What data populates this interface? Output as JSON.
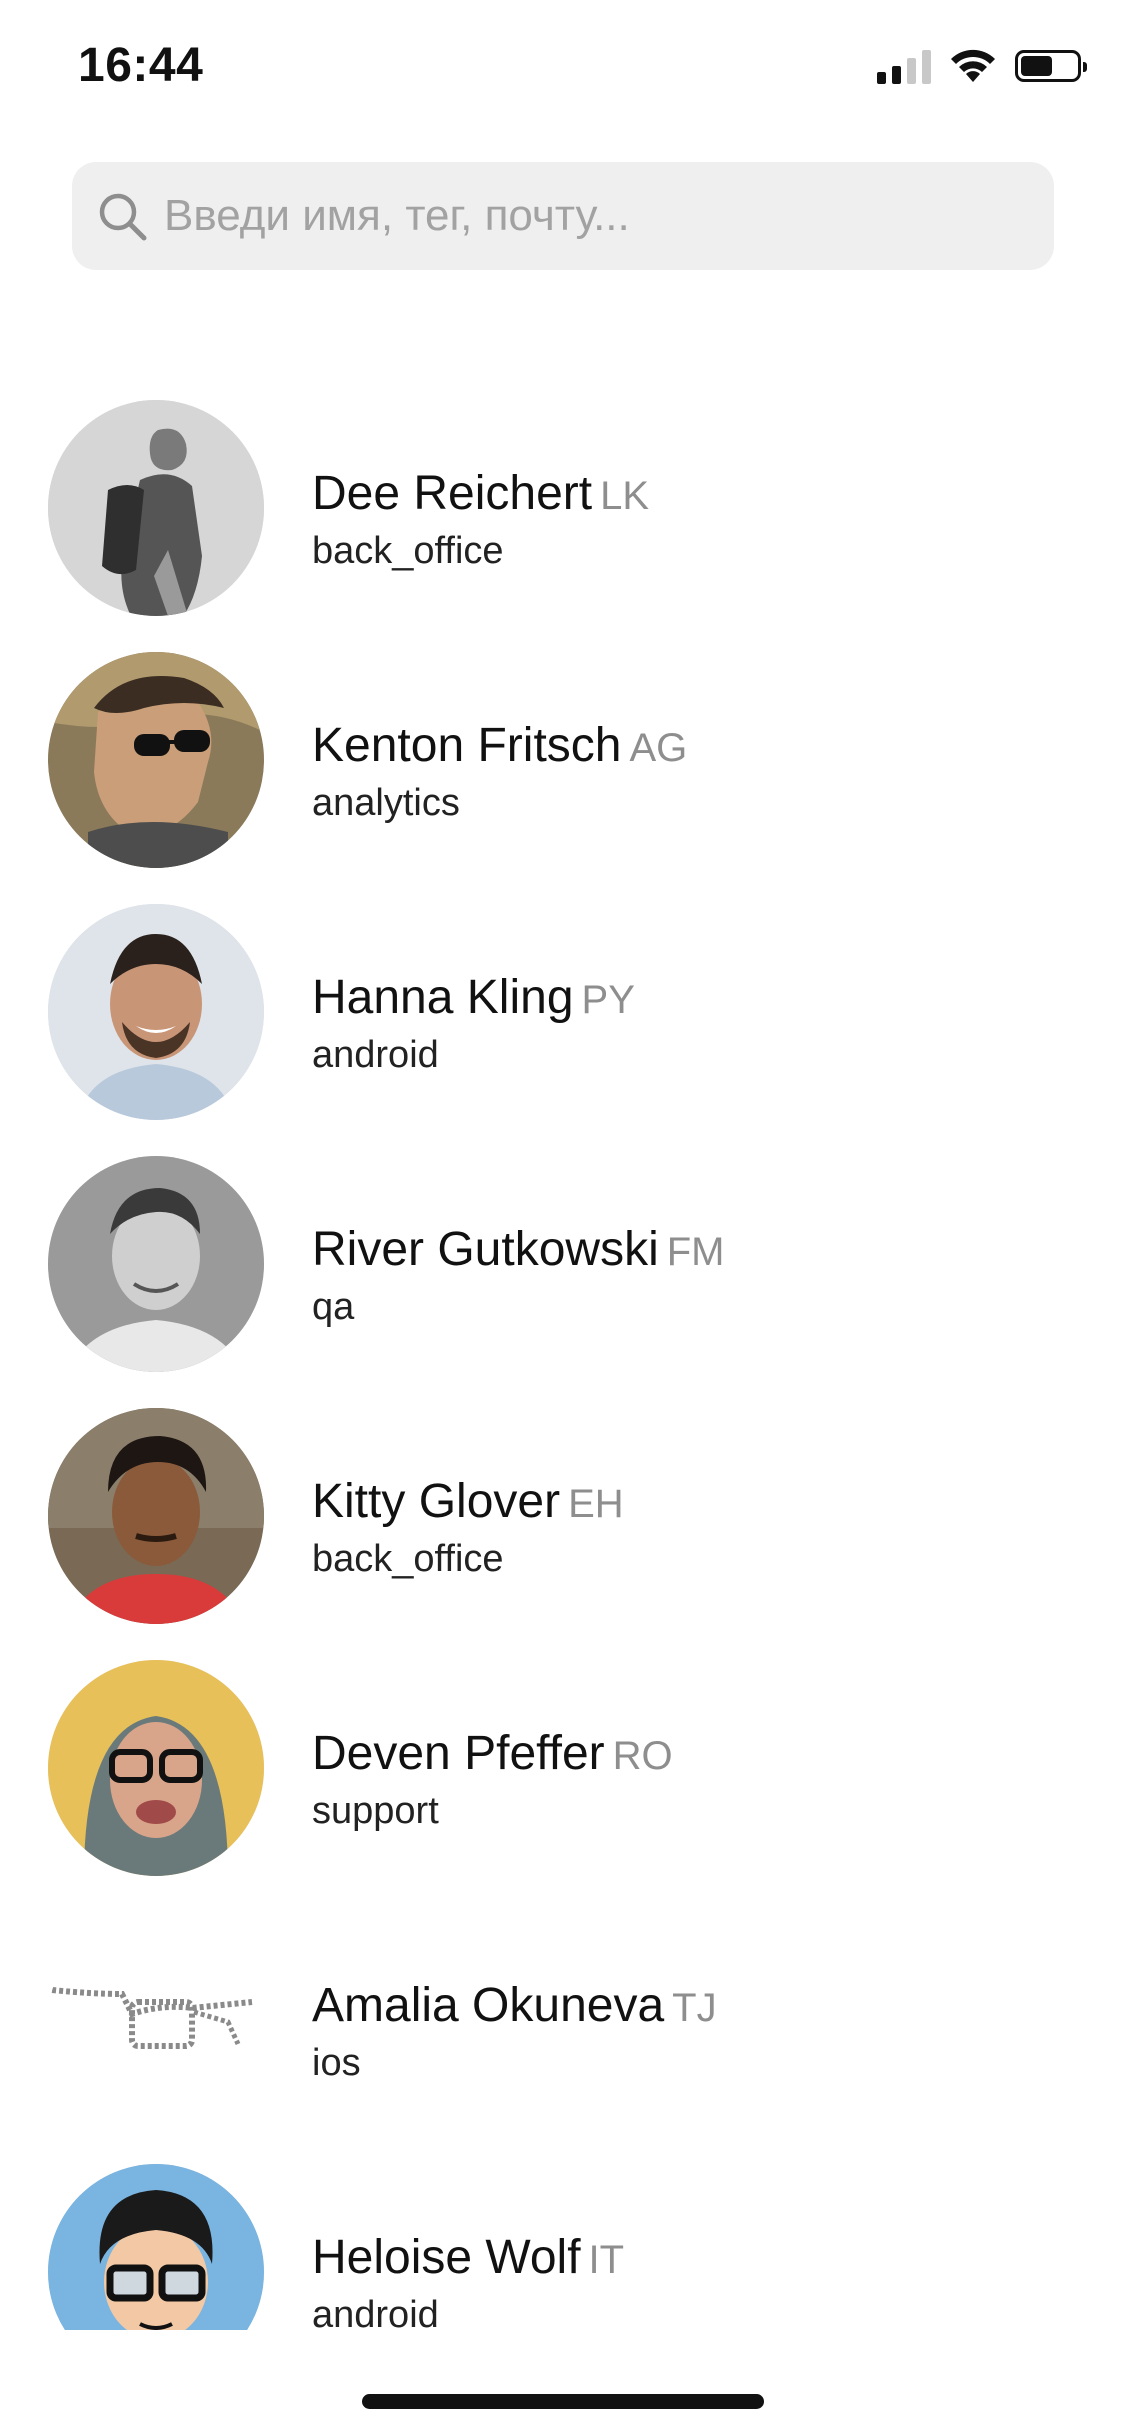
{
  "status_bar": {
    "time": "16:44",
    "icons": [
      "cellular-signal-icon",
      "wifi-icon",
      "battery-icon"
    ]
  },
  "search": {
    "placeholder": "Введи имя, тег, почту...",
    "value": "",
    "icon": "search-icon"
  },
  "contacts": [
    {
      "name": "Dee Reichert",
      "tag": "LK",
      "department": "back_office",
      "avatar": "grayscale-photo-backpack"
    },
    {
      "name": "Kenton Fritsch",
      "tag": "AG",
      "department": "analytics",
      "avatar": "photo-sunglasses"
    },
    {
      "name": "Hanna Kling",
      "tag": "PY",
      "department": "android",
      "avatar": "photo-smiling-man"
    },
    {
      "name": "River Gutkowski",
      "tag": "FM",
      "department": "qa",
      "avatar": "grayscale-photo-man"
    },
    {
      "name": "Kitty Glover",
      "tag": "EH",
      "department": "back_office",
      "avatar": "photo-man-red-shirt"
    },
    {
      "name": "Deven Pfeffer",
      "tag": "RO",
      "department": "support",
      "avatar": "photo-glasses-hood"
    },
    {
      "name": "Amalia Okuneva",
      "tag": "TJ",
      "department": "ios",
      "avatar": "glasses-sketch"
    },
    {
      "name": "Heloise Wolf",
      "tag": "IT",
      "department": "android",
      "avatar": "cartoon-glasses-man"
    }
  ],
  "colors": {
    "background": "#ffffff",
    "search_background": "#efefef",
    "placeholder": "#a2a2a2",
    "tag_text": "#8e8e8e",
    "primary_text": "#111111"
  }
}
